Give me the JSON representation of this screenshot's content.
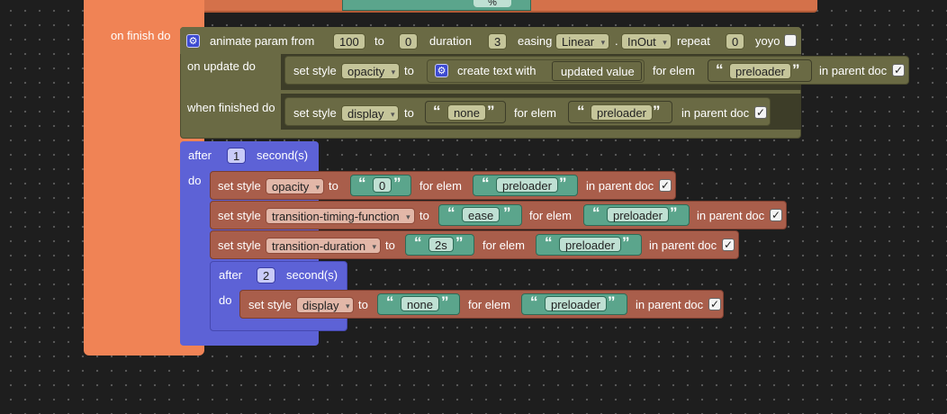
{
  "colors": {
    "event_orange": "#f08355",
    "olive": "#6a6a44",
    "style_brown": "#a95e4b",
    "timer_purple": "#5d62d6",
    "text_green": "#5ba58c"
  },
  "top_partial": {
    "value": "%"
  },
  "on_finish": {
    "label": "on finish do"
  },
  "animate": {
    "label": "animate param from",
    "from": "100",
    "to_label": "to",
    "to": "0",
    "duration_label": "duration",
    "duration": "3",
    "easing_label": "easing",
    "easing": "Linear",
    "dot": ".",
    "easing_mode": "InOut",
    "repeat_label": "repeat",
    "repeat": "0",
    "yoyo_label": "yoyo",
    "on_update_label": "on update do",
    "when_finished_label": "when finished do",
    "update_block": {
      "set_style": "set style",
      "prop": "opacity",
      "to": "to",
      "create_text": "create text with",
      "updated_value": "updated value",
      "for_elem": "for elem",
      "elem": "preloader",
      "in_parent": "in parent doc",
      "check": "✓"
    },
    "finished_block": {
      "set_style": "set style",
      "prop": "display",
      "to": "to",
      "value": "none",
      "for_elem": "for elem",
      "elem": "preloader",
      "in_parent": "in parent doc",
      "check": "✓"
    }
  },
  "after1": {
    "after_label": "after",
    "seconds": "1",
    "seconds_label": "second(s)",
    "do_label": "do",
    "rows": [
      {
        "set_style": "set style",
        "prop": "opacity",
        "to": "to",
        "value": "0",
        "for_elem": "for elem",
        "elem": "preloader",
        "in_parent": "in parent doc",
        "check": "✓"
      },
      {
        "set_style": "set style",
        "prop": "transition-timing-function",
        "to": "to",
        "value": "ease",
        "for_elem": "for elem",
        "elem": "preloader",
        "in_parent": "in parent doc",
        "check": "✓"
      },
      {
        "set_style": "set style",
        "prop": "transition-duration",
        "to": "to",
        "value": "2s",
        "for_elem": "for elem",
        "elem": "preloader",
        "in_parent": "in parent doc",
        "check": "✓"
      }
    ]
  },
  "after2": {
    "after_label": "after",
    "seconds": "2",
    "seconds_label": "second(s)",
    "do_label": "do",
    "row": {
      "set_style": "set style",
      "prop": "display",
      "to": "to",
      "value": "none",
      "for_elem": "for elem",
      "elem": "preloader",
      "in_parent": "in parent doc",
      "check": "✓"
    }
  }
}
